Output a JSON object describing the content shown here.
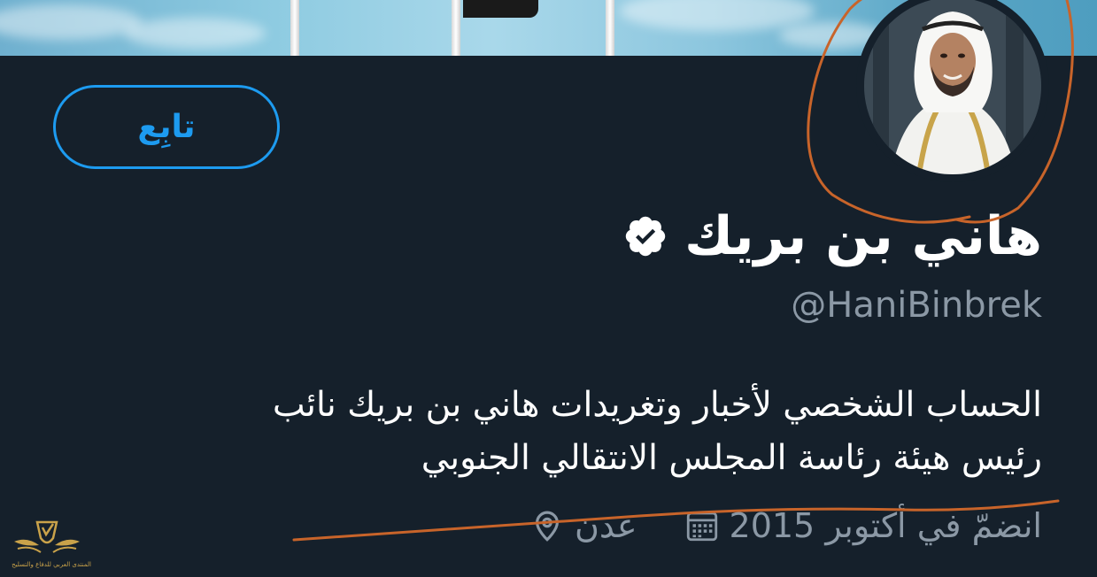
{
  "profile": {
    "follow_label": "تابِع",
    "display_name": "هاني بن بريك",
    "handle": "@HaniBinbrek",
    "bio_line_1": "الحساب الشخصي لأخبار وتغريدات هاني بن بريك نائب",
    "bio_line_2": "رئيس هيئة رئاسة المجلس الانتقالي الجنوبي",
    "location": "عدن",
    "joined": "انضمّ في أكتوبر 2015"
  },
  "icons": {
    "verified": "verified-badge-icon",
    "location": "location-pin-icon",
    "calendar": "calendar-icon"
  },
  "watermark": {
    "text": "المنتدى العربي للدفاع والتسليح"
  },
  "colors": {
    "background": "#15202b",
    "accent": "#1d9bf0",
    "secondary_text": "#8b98a5",
    "annotation": "#c8642a"
  }
}
